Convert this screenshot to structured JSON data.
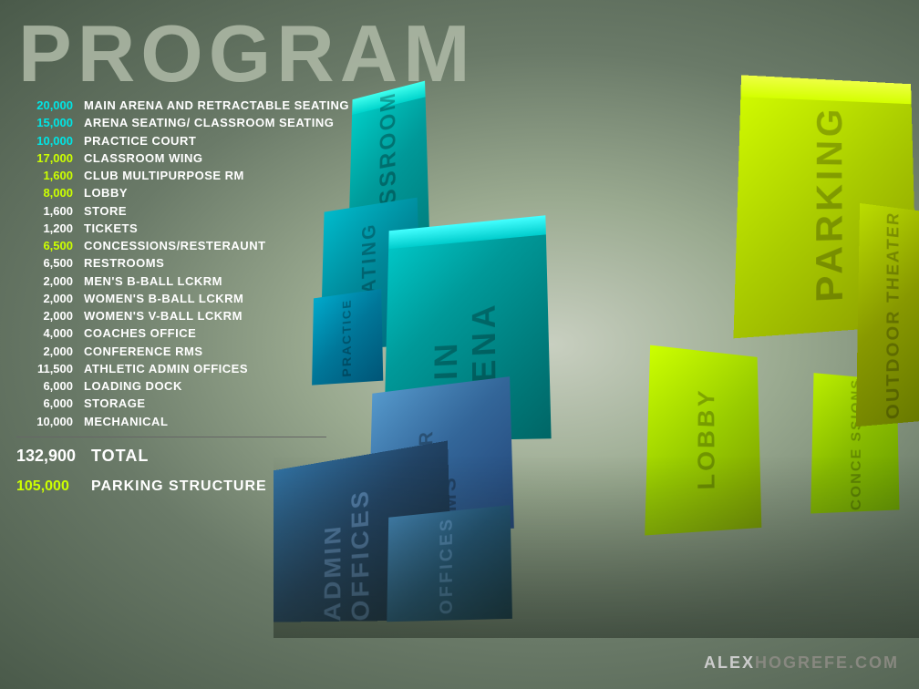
{
  "page": {
    "title": "PROGRAM",
    "branding": {
      "prefix": "ALEX",
      "suffix": "HOGREFE.COM"
    }
  },
  "program_items": [
    {
      "number": "20,000",
      "label": "MAIN ARENA AND RETRACTABLE SEATING",
      "color": "cyan"
    },
    {
      "number": "15,000",
      "label": "ARENA SEATING/ CLASSROOM SEATING",
      "color": "cyan"
    },
    {
      "number": "10,000",
      "label": "PRACTICE COURT",
      "color": "cyan"
    },
    {
      "number": "17,000",
      "label": "CLASSROOM WING",
      "color": "yellow"
    },
    {
      "number": "1,600",
      "label": "CLUB MULTIPURPOSE RM",
      "color": "yellow"
    },
    {
      "number": "8,000",
      "label": "LOBBY",
      "color": "yellow"
    },
    {
      "number": "1,600",
      "label": "STORE",
      "color": "white"
    },
    {
      "number": "1,200",
      "label": "TICKETS",
      "color": "white"
    },
    {
      "number": "6,500",
      "label": "CONCESSIONS/RESTERAUNT",
      "color": "yellow"
    },
    {
      "number": "6,500",
      "label": "RESTROOMS",
      "color": "white"
    },
    {
      "number": "2,000",
      "label": "MEN'S B-BALL LCKRM",
      "color": "white"
    },
    {
      "number": "2,000",
      "label": "WOMEN'S B-BALL LCKRM",
      "color": "white"
    },
    {
      "number": "2,000",
      "label": "WOMEN'S V-BALL LCKRM",
      "color": "white"
    },
    {
      "number": "4,000",
      "label": "COACHES OFFICE",
      "color": "white"
    },
    {
      "number": "2,000",
      "label": "CONFERENCE RMS",
      "color": "white"
    },
    {
      "number": "11,500",
      "label": "ATHLETIC ADMIN OFFICES",
      "color": "white"
    },
    {
      "number": "6,000",
      "label": "LOADING DOCK",
      "color": "white"
    },
    {
      "number": "6,000",
      "label": "STORAGE",
      "color": "white"
    },
    {
      "number": "10,000",
      "label": "MECHANICAL",
      "color": "white"
    }
  ],
  "total": {
    "number": "132,900",
    "label": "TOTAL"
  },
  "parking": {
    "number": "105,000",
    "label": "PARKING STRUCTURE",
    "color": "yellow"
  },
  "blocks": {
    "classroom": "CLASSROOM",
    "parking": "PARKING",
    "seating": "SEATING",
    "arena": "MAIN ARENA",
    "practice": "PRACTICE COURT",
    "lobby": "LOBBY",
    "concessions": "CONCESSIONS",
    "theater": "OUTDOOR THEATER",
    "locker": "LOCKER RMS",
    "admin": "ADMIN OFFICES",
    "offices": "OFFICES"
  }
}
